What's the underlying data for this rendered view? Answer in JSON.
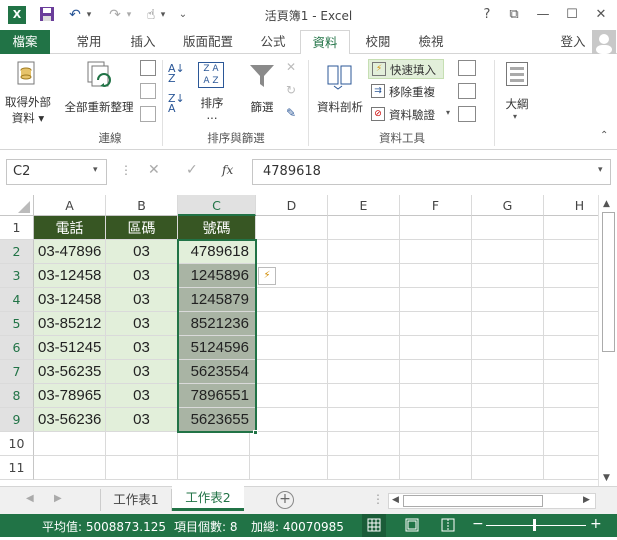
{
  "title": "活頁簿1 - Excel",
  "window_buttons": [
    "?",
    "⧉",
    "—",
    "☐",
    "✕"
  ],
  "tabs": [
    {
      "label": "檔案"
    },
    {
      "label": "常用"
    },
    {
      "label": "插入"
    },
    {
      "label": "版面配置"
    },
    {
      "label": "公式"
    },
    {
      "label": "資料"
    },
    {
      "label": "校閱"
    },
    {
      "label": "檢視"
    }
  ],
  "signin": "登入",
  "ribbon": {
    "get_external": [
      "取得外部",
      "資料 ▾"
    ],
    "refresh_all": "全部重新整理",
    "sort": "排序",
    "sort_dots": "...",
    "filter": "篩選",
    "text_to_columns": "資料剖析",
    "flash_fill": "快速填入",
    "remove_duplicates": "移除重複",
    "data_validation": "資料驗證",
    "outline": "大綱",
    "groups": [
      "連線",
      "排序與篩選",
      "資料工具"
    ]
  },
  "name_box": "C2",
  "fx": "fx",
  "formula_value": "4789618",
  "columns": [
    "A",
    "B",
    "C",
    "D",
    "E",
    "F",
    "G",
    "H"
  ],
  "rows": [
    "1",
    "2",
    "3",
    "4",
    "5",
    "6",
    "7",
    "8",
    "9",
    "10",
    "11"
  ],
  "table_header": [
    "電話",
    "區碼",
    "號碼"
  ],
  "table_rows": [
    [
      "03-47896",
      "03",
      "4789618"
    ],
    [
      "03-12458",
      "03",
      "1245896"
    ],
    [
      "03-12458",
      "03",
      "1245879"
    ],
    [
      "03-85212",
      "03",
      "8521236"
    ],
    [
      "03-51245",
      "03",
      "5124596"
    ],
    [
      "03-56235",
      "03",
      "5623554"
    ],
    [
      "03-78965",
      "03",
      "7896551"
    ],
    [
      "03-56236",
      "03",
      "5623655"
    ]
  ],
  "sheets": [
    {
      "label": "工作表1"
    },
    {
      "label": "工作表2"
    }
  ],
  "status": {
    "average": "平均值: 5008873.125",
    "count": "項目個數: 8",
    "sum": "加總: 40070985",
    "zoom_minus": "−",
    "zoom_plus": "+"
  },
  "colors": {
    "accent": "#217346",
    "header_fill": "#375623",
    "table_fill": "#e2efda",
    "selection": "#a9b4a4"
  }
}
